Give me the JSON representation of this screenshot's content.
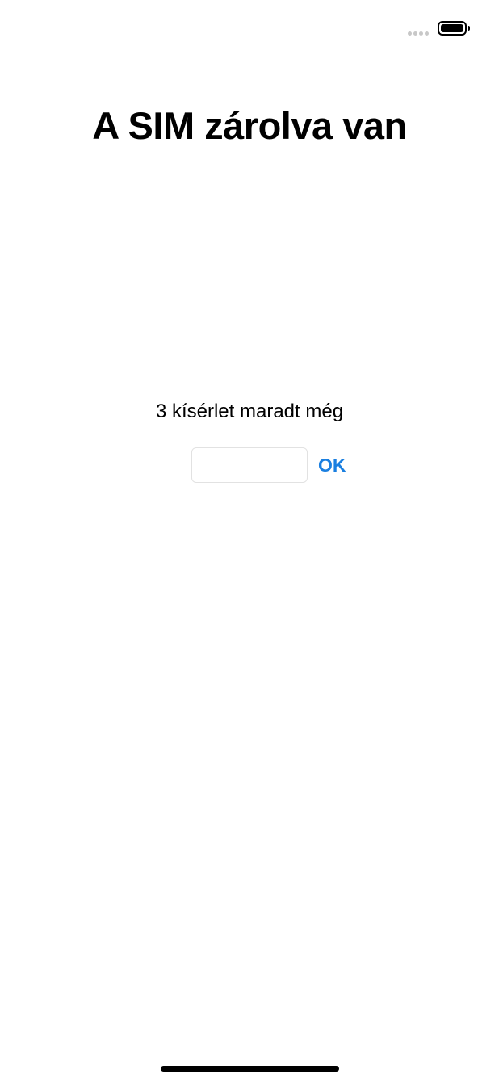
{
  "status_bar": {
    "signal_icon": "signal-dots-icon",
    "battery_icon": "battery-full-icon"
  },
  "screen": {
    "title": "A SIM zárolva van",
    "attempts_text": "3 kísérlet maradt még",
    "pin_input": {
      "value": "",
      "placeholder": ""
    },
    "ok_label": "OK"
  },
  "colors": {
    "accent": "#1a7fe0",
    "background": "#ffffff",
    "text": "#000000"
  }
}
